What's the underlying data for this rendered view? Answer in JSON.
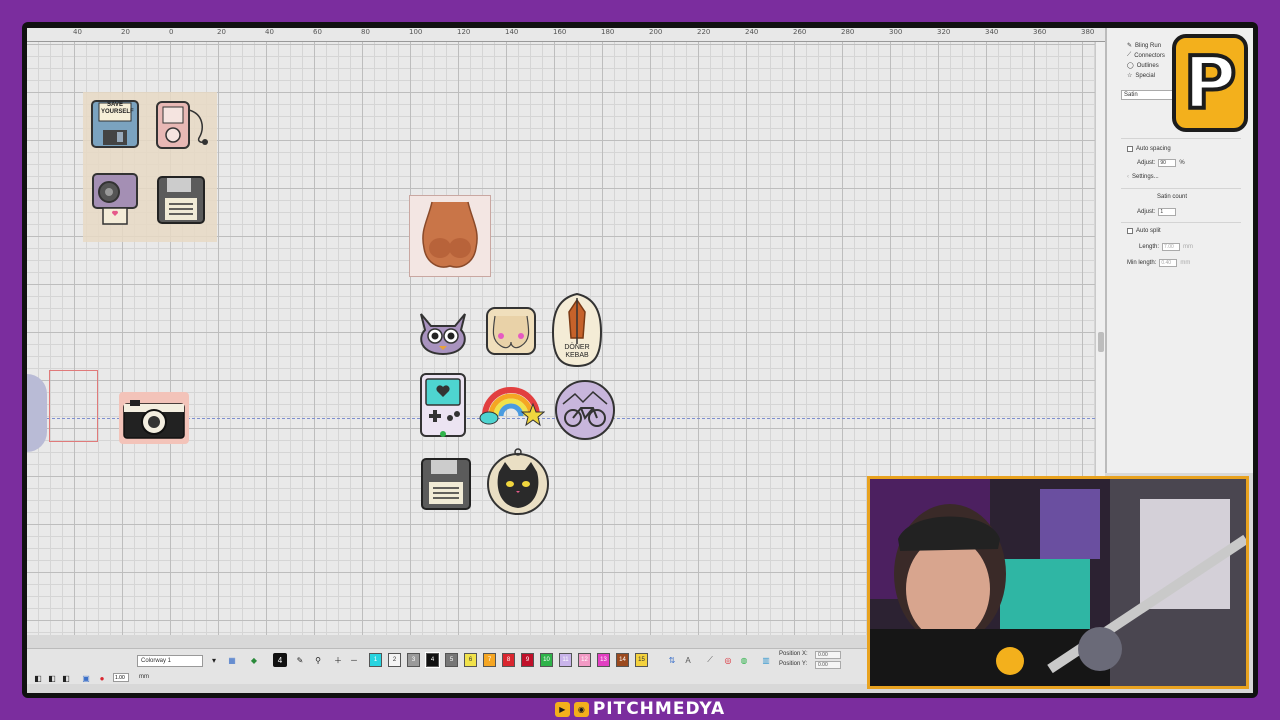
{
  "ruler": {
    "labels": [
      "40",
      "20",
      "0",
      "20",
      "40",
      "60",
      "80",
      "100",
      "120",
      "140",
      "160",
      "180",
      "200",
      "220",
      "240",
      "260",
      "280",
      "300",
      "320",
      "340",
      "360",
      "380"
    ]
  },
  "panel": {
    "objects_list": [
      "Bling Run",
      "Connectors",
      "Outlines",
      "Special"
    ],
    "stitch_type": "Satin",
    "auto_spacing_label": "Auto spacing",
    "adjust_label": "Adjust:",
    "adjust_value": "90",
    "adjust_unit": "%",
    "settings_label": "Settings...",
    "satin_count_label": "Satin count",
    "satin_adjust_label": "Adjust:",
    "satin_adjust_value": "1",
    "auto_split_label": "Auto split",
    "length_label": "Length:",
    "length_value": "7.00",
    "length_unit": "mm",
    "min_length_label": "Min length:",
    "min_length_value": "0.40",
    "min_length_unit": "mm"
  },
  "patches": {
    "save_yourself_text": "SAVE YOURSELF",
    "doner_kebab_text": "DÖNER KEBAB"
  },
  "toolbar": {
    "colorway": "Colorway 1",
    "zoom_value": "1.00",
    "unit": "mm",
    "position_x_label": "Position X:",
    "position_y_label": "Position Y:",
    "position_x_value": "0.00",
    "position_y_value": "0.00",
    "swatches": [
      {
        "num": "1",
        "color": "#27d4e0"
      },
      {
        "num": "2",
        "color": "#f4f4f4"
      },
      {
        "num": "3",
        "color": "#9a9a9a"
      },
      {
        "num": "4",
        "color": "#111111"
      },
      {
        "num": "5",
        "color": "#777777"
      },
      {
        "num": "6",
        "color": "#f1e24b"
      },
      {
        "num": "7",
        "color": "#f5a623"
      },
      {
        "num": "8",
        "color": "#d9262f"
      },
      {
        "num": "9",
        "color": "#c0102a"
      },
      {
        "num": "10",
        "color": "#2fb34a"
      },
      {
        "num": "11",
        "color": "#c9b4ea"
      },
      {
        "num": "12",
        "color": "#f29ac5"
      },
      {
        "num": "13",
        "color": "#e23fc2"
      },
      {
        "num": "14",
        "color": "#9b4a1f"
      },
      {
        "num": "15",
        "color": "#f4d23e"
      }
    ]
  },
  "overlay": {
    "logo_letter": "P",
    "channel_name": "PITCHMEDYA"
  },
  "colors": {
    "background": "#7b2d9e",
    "accent": "#f3b01c",
    "guide": "#7f8fcf"
  }
}
